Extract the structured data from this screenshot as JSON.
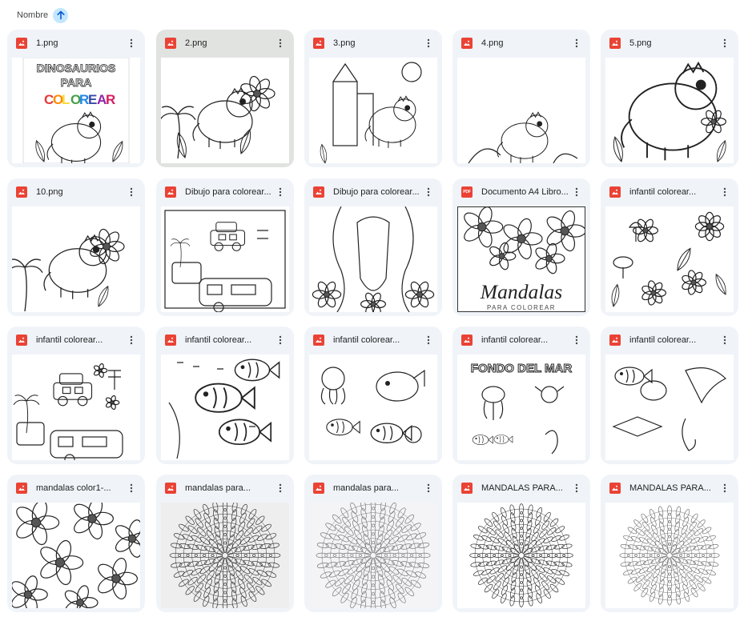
{
  "sort": {
    "label": "Nombre",
    "direction": "ascending"
  },
  "files": [
    {
      "name": "1.png",
      "type": "image",
      "thumb_title": [
        "DINOSAURIOS",
        "PARA",
        "COLOREAR"
      ]
    },
    {
      "name": "2.png",
      "type": "image",
      "selected": true
    },
    {
      "name": "3.png",
      "type": "image"
    },
    {
      "name": "4.png",
      "type": "image"
    },
    {
      "name": "5.png",
      "type": "image"
    },
    {
      "name": "10.png",
      "type": "image"
    },
    {
      "name": "Dibujo para colorear...",
      "type": "image"
    },
    {
      "name": "Dibujo para colorear...",
      "type": "image"
    },
    {
      "name": "Documento A4 Libro...",
      "type": "pdf",
      "thumb_title": [
        "Mandalas",
        "PARA COLOREAR"
      ]
    },
    {
      "name": "infantil colorear...",
      "type": "image"
    },
    {
      "name": "infantil colorear...",
      "type": "image"
    },
    {
      "name": "infantil colorear...",
      "type": "image"
    },
    {
      "name": "infantil colorear...",
      "type": "image"
    },
    {
      "name": "infantil colorear...",
      "type": "image",
      "thumb_title": [
        "FONDO DEL MAR"
      ]
    },
    {
      "name": "infantil colorear...",
      "type": "image"
    },
    {
      "name": "mandalas color1-...",
      "type": "image"
    },
    {
      "name": "mandalas para...",
      "type": "image"
    },
    {
      "name": "mandalas para...",
      "type": "image"
    },
    {
      "name": "MANDALAS PARA...",
      "type": "image"
    },
    {
      "name": "MANDALAS PARA...",
      "type": "image"
    }
  ],
  "colors": {
    "card_bg": "#f0f4f9",
    "card_selected_bg": "#e1e3e1",
    "image_icon": "#ea4335",
    "pdf_icon": "#ea4335",
    "sort_button_bg": "#c2e7ff",
    "sort_arrow": "#0b57d0"
  },
  "icons": {
    "sort": "arrow-up-icon",
    "image": "image-file-icon",
    "pdf": "pdf-file-icon",
    "menu": "more-vert-icon"
  }
}
